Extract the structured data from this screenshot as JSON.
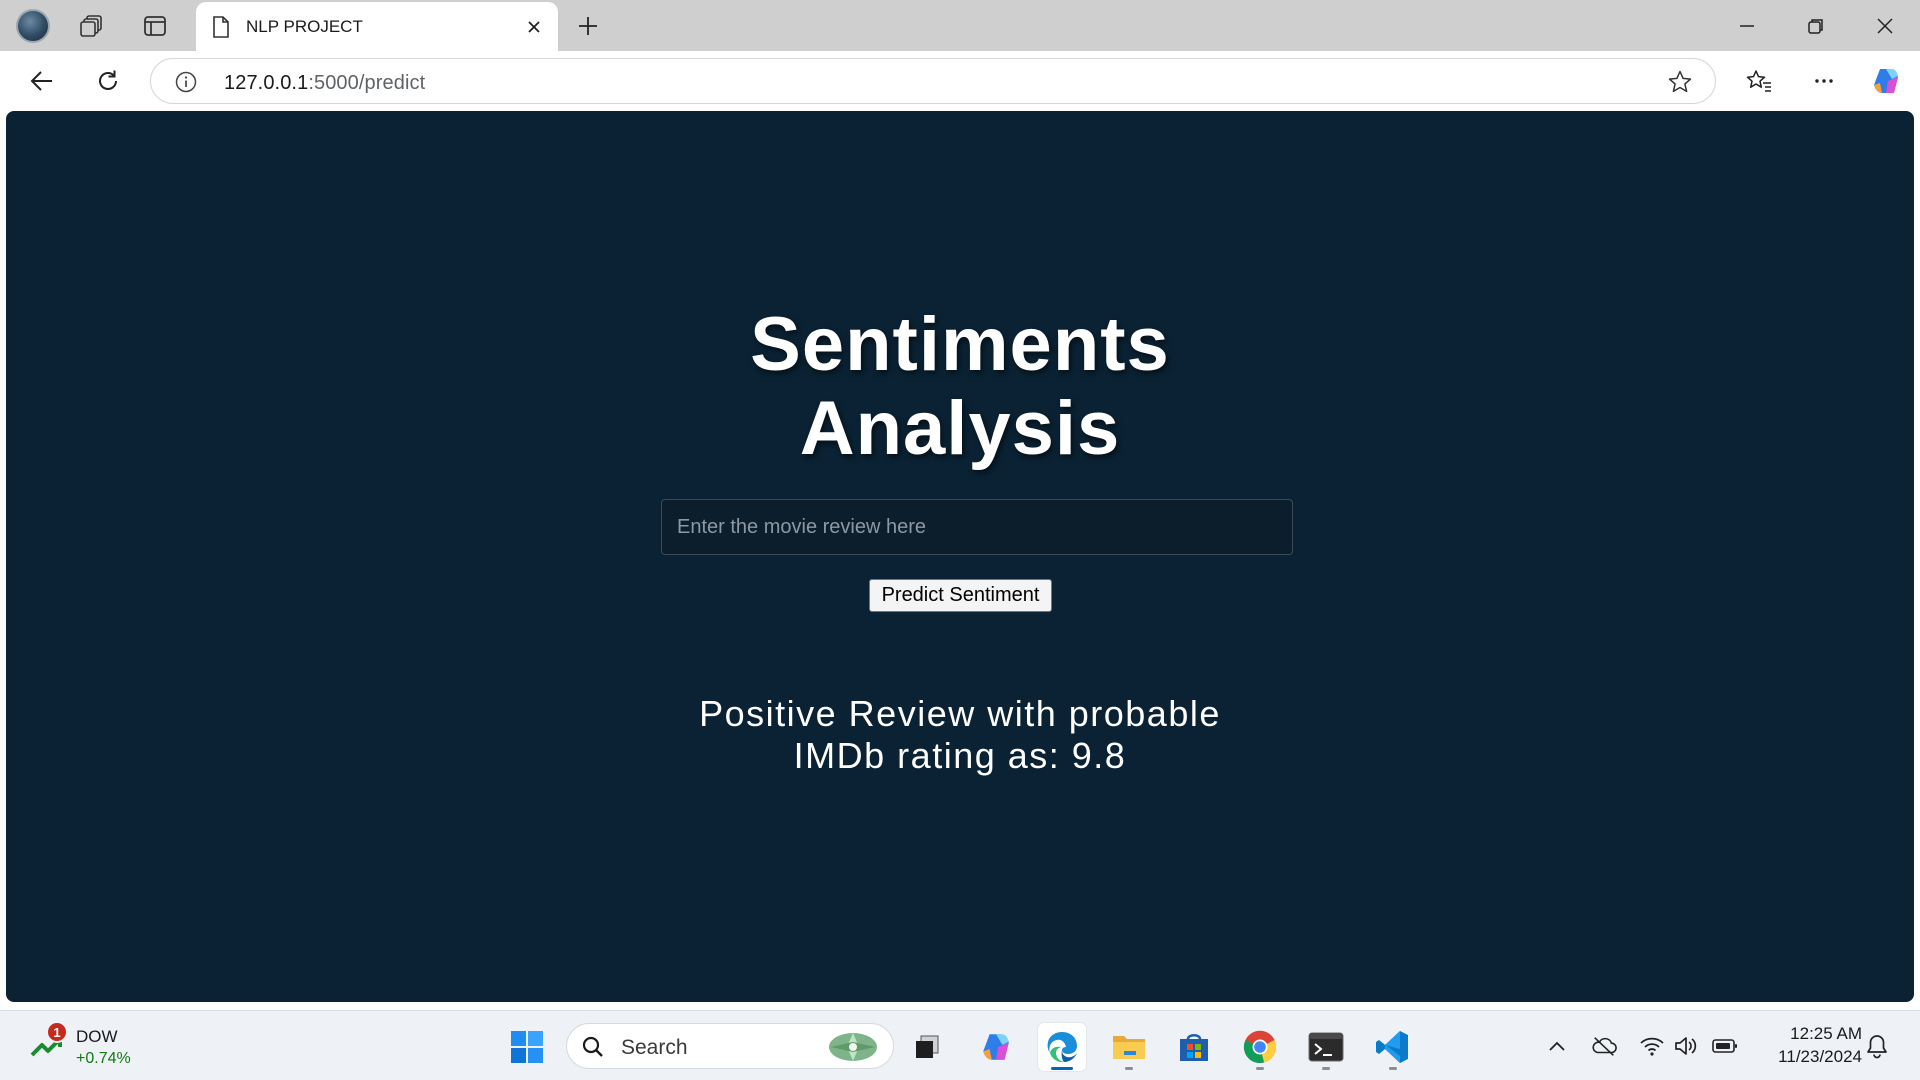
{
  "browser": {
    "tab": {
      "title": "NLP PROJECT"
    },
    "address": {
      "host": "127.0.0.1",
      "path": ":5000/predict"
    }
  },
  "page": {
    "title_line1": "Sentiments",
    "title_line2": "Analysis",
    "input": {
      "placeholder": "Enter the movie review here",
      "value": ""
    },
    "predict_button": "Predict Sentiment",
    "result_line1": "Positive Review with probable",
    "result_line2": "IMDb rating as: 9.8",
    "background_color": "#0a2233"
  },
  "taskbar": {
    "widget": {
      "label": "DOW",
      "change": "+0.74%",
      "badge": "1"
    },
    "search": {
      "label": "Search"
    },
    "apps": [
      "start-icon",
      "search",
      "task-view-icon",
      "copilot-icon",
      "edge-icon",
      "file-explorer-icon",
      "microsoft-store-icon",
      "chrome-icon",
      "terminal-icon",
      "vscode-icon"
    ],
    "clock": {
      "time": "12:25 AM",
      "date": "11/23/2024"
    }
  }
}
